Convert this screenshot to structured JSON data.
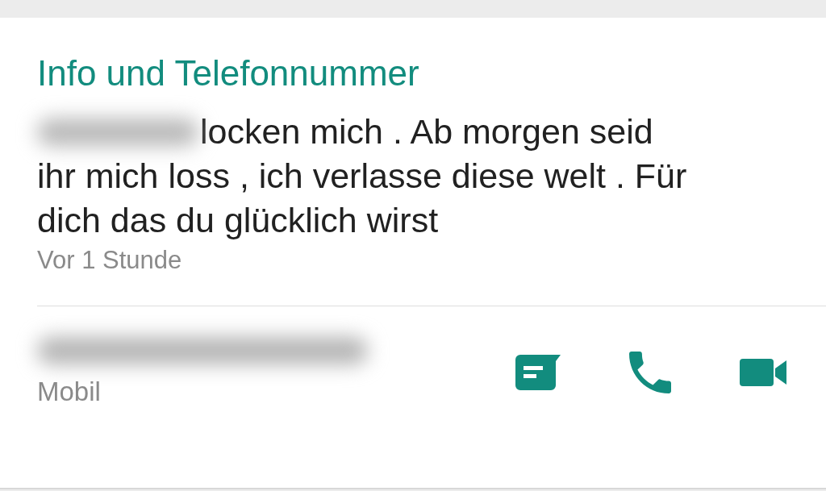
{
  "section_title": "Info und Telefonnummer",
  "about": {
    "lines": [
      "locken mich . Ab morgen seid",
      "ihr mich loss , ich verlasse diese welt . Für",
      "dich das du glücklich wirst"
    ],
    "time": "Vor 1 Stunde"
  },
  "phone": {
    "label": "Mobil"
  }
}
